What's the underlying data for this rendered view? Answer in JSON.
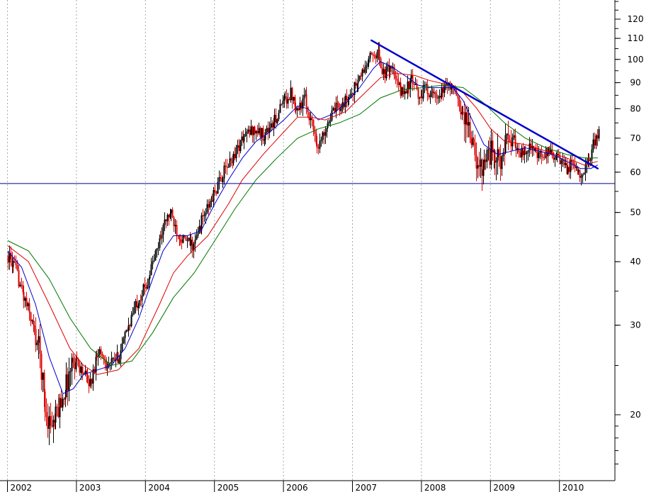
{
  "chart_data": {
    "type": "candlestick",
    "y_scale": "log",
    "ylim": [
      16,
      135
    ],
    "xlim": [
      2002.0,
      2010.62
    ],
    "grid": {
      "vertical": true,
      "horizontal": false,
      "style": "dotted"
    },
    "y_ticks": [
      {
        "value": 20,
        "label": "20"
      },
      {
        "value": 30,
        "label": "30"
      },
      {
        "value": 40,
        "label": "40"
      },
      {
        "value": 50,
        "label": "50"
      },
      {
        "value": 60,
        "label": "60"
      },
      {
        "value": 70,
        "label": "70"
      },
      {
        "value": 80,
        "label": "80"
      },
      {
        "value": 90,
        "label": "90"
      },
      {
        "value": 100,
        "label": "100"
      },
      {
        "value": 110,
        "label": "110"
      },
      {
        "value": 120,
        "label": "120"
      }
    ],
    "x_ticks": [
      {
        "value": 2002,
        "label": "2002"
      },
      {
        "value": 2003,
        "label": "2003"
      },
      {
        "value": 2004,
        "label": "2004"
      },
      {
        "value": 2005,
        "label": "2005"
      },
      {
        "value": 2006,
        "label": "2006"
      },
      {
        "value": 2007,
        "label": "2007"
      },
      {
        "value": 2008,
        "label": "2008"
      },
      {
        "value": 2009,
        "label": "2009"
      },
      {
        "value": 2010,
        "label": "2010"
      }
    ],
    "price_path": [
      [
        2002.0,
        41
      ],
      [
        2002.1,
        39
      ],
      [
        2002.2,
        35
      ],
      [
        2002.3,
        32
      ],
      [
        2002.45,
        27
      ],
      [
        2002.55,
        20
      ],
      [
        2002.65,
        19
      ],
      [
        2002.75,
        21
      ],
      [
        2002.85,
        23
      ],
      [
        2002.95,
        26
      ],
      [
        2003.1,
        24
      ],
      [
        2003.2,
        23
      ],
      [
        2003.3,
        27
      ],
      [
        2003.45,
        25
      ],
      [
        2003.6,
        26
      ],
      [
        2003.75,
        30
      ],
      [
        2003.85,
        33
      ],
      [
        2004.0,
        36
      ],
      [
        2004.15,
        42
      ],
      [
        2004.25,
        47
      ],
      [
        2004.35,
        50
      ],
      [
        2004.45,
        46
      ],
      [
        2004.55,
        44
      ],
      [
        2004.7,
        43
      ],
      [
        2004.8,
        48
      ],
      [
        2004.95,
        53
      ],
      [
        2005.1,
        59
      ],
      [
        2005.25,
        64
      ],
      [
        2005.4,
        70
      ],
      [
        2005.55,
        73
      ],
      [
        2005.7,
        71
      ],
      [
        2005.85,
        75
      ],
      [
        2006.0,
        83
      ],
      [
        2006.1,
        86
      ],
      [
        2006.2,
        80
      ],
      [
        2006.3,
        84
      ],
      [
        2006.4,
        75
      ],
      [
        2006.5,
        67
      ],
      [
        2006.62,
        75
      ],
      [
        2006.75,
        80
      ],
      [
        2006.9,
        83
      ],
      [
        2007.0,
        87
      ],
      [
        2007.1,
        92
      ],
      [
        2007.2,
        98
      ],
      [
        2007.28,
        102
      ],
      [
        2007.35,
        104
      ],
      [
        2007.45,
        93
      ],
      [
        2007.55,
        98
      ],
      [
        2007.62,
        90
      ],
      [
        2007.72,
        86
      ],
      [
        2007.85,
        91
      ],
      [
        2007.95,
        84
      ],
      [
        2008.05,
        88
      ],
      [
        2008.15,
        85
      ],
      [
        2008.25,
        83
      ],
      [
        2008.35,
        90
      ],
      [
        2008.45,
        88
      ],
      [
        2008.55,
        80
      ],
      [
        2008.65,
        76
      ],
      [
        2008.72,
        70
      ],
      [
        2008.8,
        60
      ],
      [
        2008.9,
        64
      ],
      [
        2009.0,
        66
      ],
      [
        2009.1,
        63
      ],
      [
        2009.2,
        67
      ],
      [
        2009.3,
        70
      ],
      [
        2009.45,
        65
      ],
      [
        2009.55,
        68
      ],
      [
        2009.65,
        65
      ],
      [
        2009.75,
        64
      ],
      [
        2009.85,
        66
      ],
      [
        2010.0,
        63
      ],
      [
        2010.08,
        61
      ],
      [
        2010.18,
        62
      ],
      [
        2010.3,
        60
      ],
      [
        2010.4,
        62
      ],
      [
        2010.48,
        68
      ],
      [
        2010.55,
        71
      ]
    ],
    "moving_averages": [
      {
        "color": "#0000cc",
        "points": [
          [
            2002.0,
            42
          ],
          [
            2002.2,
            39
          ],
          [
            2002.4,
            33
          ],
          [
            2002.6,
            26
          ],
          [
            2002.8,
            22
          ],
          [
            2002.95,
            22.5
          ],
          [
            2003.1,
            24
          ],
          [
            2003.3,
            24.5
          ],
          [
            2003.5,
            25
          ],
          [
            2003.7,
            27
          ],
          [
            2003.9,
            31
          ],
          [
            2004.1,
            37
          ],
          [
            2004.25,
            42
          ],
          [
            2004.4,
            45
          ],
          [
            2004.6,
            45
          ],
          [
            2004.8,
            46
          ],
          [
            2005.0,
            52
          ],
          [
            2005.2,
            58
          ],
          [
            2005.4,
            64
          ],
          [
            2005.6,
            69
          ],
          [
            2005.8,
            72
          ],
          [
            2006.0,
            76
          ],
          [
            2006.2,
            81
          ],
          [
            2006.35,
            80
          ],
          [
            2006.5,
            76
          ],
          [
            2006.7,
            78
          ],
          [
            2006.9,
            82
          ],
          [
            2007.1,
            88
          ],
          [
            2007.3,
            96
          ],
          [
            2007.4,
            99
          ],
          [
            2007.55,
            97
          ],
          [
            2007.75,
            93
          ],
          [
            2007.95,
            89
          ],
          [
            2008.1,
            88
          ],
          [
            2008.3,
            88
          ],
          [
            2008.45,
            88
          ],
          [
            2008.6,
            83
          ],
          [
            2008.75,
            75
          ],
          [
            2008.9,
            68
          ],
          [
            2009.1,
            65
          ],
          [
            2009.3,
            66
          ],
          [
            2009.5,
            67
          ],
          [
            2009.7,
            66
          ],
          [
            2009.9,
            65
          ],
          [
            2010.1,
            63
          ],
          [
            2010.3,
            61
          ],
          [
            2010.45,
            61
          ],
          [
            2010.55,
            62
          ]
        ]
      },
      {
        "color": "#dd0000",
        "points": [
          [
            2002.0,
            43
          ],
          [
            2002.3,
            40
          ],
          [
            2002.6,
            33
          ],
          [
            2002.9,
            27
          ],
          [
            2003.1,
            25
          ],
          [
            2003.3,
            24
          ],
          [
            2003.6,
            24.5
          ],
          [
            2003.9,
            27
          ],
          [
            2004.2,
            33
          ],
          [
            2004.4,
            38
          ],
          [
            2004.6,
            41
          ],
          [
            2004.9,
            45
          ],
          [
            2005.2,
            52
          ],
          [
            2005.4,
            58
          ],
          [
            2005.7,
            65
          ],
          [
            2006.0,
            72
          ],
          [
            2006.2,
            77
          ],
          [
            2006.4,
            77
          ],
          [
            2006.6,
            76
          ],
          [
            2006.9,
            79
          ],
          [
            2007.1,
            84
          ],
          [
            2007.4,
            92
          ],
          [
            2007.6,
            94
          ],
          [
            2007.9,
            93
          ],
          [
            2008.1,
            91
          ],
          [
            2008.4,
            89
          ],
          [
            2008.6,
            86
          ],
          [
            2008.8,
            80
          ],
          [
            2009.0,
            73
          ],
          [
            2009.2,
            69
          ],
          [
            2009.5,
            68
          ],
          [
            2009.8,
            66
          ],
          [
            2010.1,
            64
          ],
          [
            2010.35,
            62
          ],
          [
            2010.55,
            63
          ]
        ]
      },
      {
        "color": "#007700",
        "points": [
          [
            2002.0,
            44
          ],
          [
            2002.3,
            42
          ],
          [
            2002.6,
            37
          ],
          [
            2002.9,
            31
          ],
          [
            2003.2,
            27
          ],
          [
            2003.5,
            25
          ],
          [
            2003.8,
            25.5
          ],
          [
            2004.1,
            29
          ],
          [
            2004.4,
            34
          ],
          [
            2004.7,
            38
          ],
          [
            2005.0,
            44
          ],
          [
            2005.3,
            51
          ],
          [
            2005.6,
            58
          ],
          [
            2005.9,
            64
          ],
          [
            2006.2,
            70
          ],
          [
            2006.5,
            73
          ],
          [
            2006.8,
            75
          ],
          [
            2007.1,
            78
          ],
          [
            2007.4,
            84
          ],
          [
            2007.7,
            87
          ],
          [
            2008.0,
            88
          ],
          [
            2008.3,
            89
          ],
          [
            2008.6,
            88
          ],
          [
            2008.9,
            82
          ],
          [
            2009.2,
            75
          ],
          [
            2009.5,
            70
          ],
          [
            2009.8,
            67
          ],
          [
            2010.1,
            65
          ],
          [
            2010.35,
            64
          ],
          [
            2010.55,
            64
          ]
        ]
      }
    ],
    "annotations": [
      {
        "type": "trendline",
        "color": "#0000cc",
        "from": [
          2007.27,
          109
        ],
        "to": [
          2010.55,
          61
        ]
      },
      {
        "type": "horizontal_line",
        "color": "#000099",
        "y": 57
      }
    ]
  }
}
